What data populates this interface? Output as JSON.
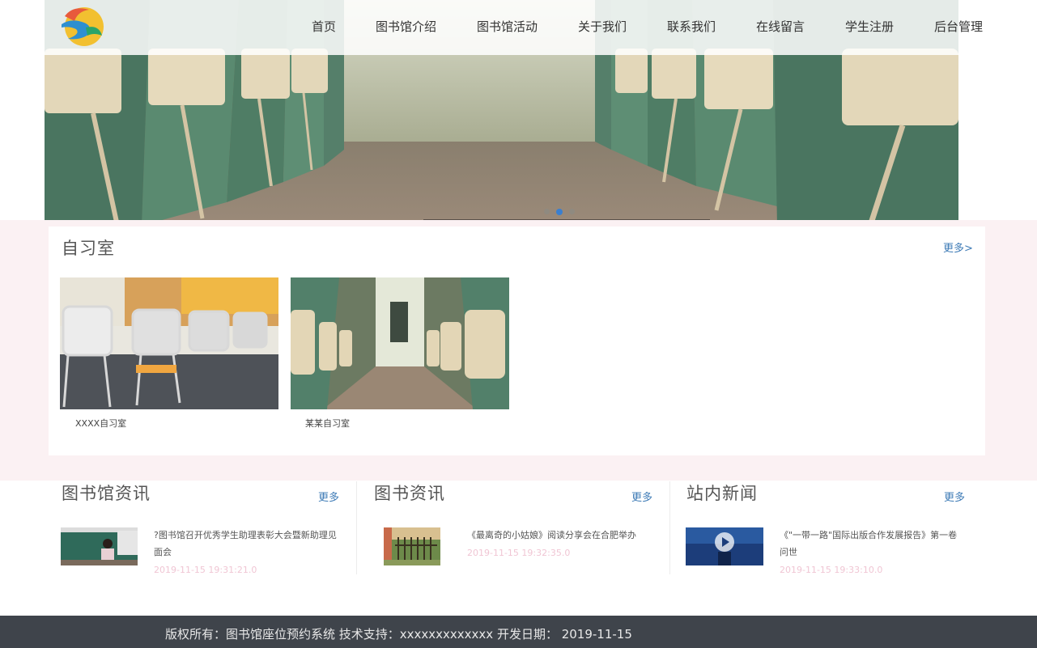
{
  "nav": {
    "items": [
      "首页",
      "图书馆介绍",
      "图书馆活动",
      "关于我们",
      "联系我们",
      "在线留言",
      "学生注册",
      "后台管理"
    ]
  },
  "banner": {
    "slides": 3,
    "active_slide": 2
  },
  "study": {
    "title": "自习室",
    "more": "更多>",
    "rooms": [
      {
        "label": "XXXX自习室"
      },
      {
        "label": "某某自习室"
      }
    ]
  },
  "news_sections": [
    {
      "title": "图书馆资讯",
      "more": "更多",
      "item": {
        "text": "?图书馆召开优秀学生助理表彰大会暨新助理见面会",
        "date": "2019-11-15 19:31:21.0"
      }
    },
    {
      "title": "图书资讯",
      "more": "更多",
      "item": {
        "text": "《最离奇的小姑娘》阅读分享会在合肥举办",
        "date": "2019-11-15 19:32:35.0"
      }
    },
    {
      "title": "站内新闻",
      "more": "更多",
      "item": {
        "text": "《\"一带一路\"国际出版合作发展报告》第一卷问世",
        "date": "2019-11-15 19:33:10.0"
      }
    }
  ],
  "footer": {
    "text": "版权所有：图书馆座位预约系统 技术支持：xxxxxxxxxxxxx 开发日期： 2019-11-15"
  },
  "colors": {
    "accent": "#3e7bb6",
    "footer_bg": "#3f444b",
    "pink_band": "#fbf1f3",
    "date": "#f0c6d4"
  }
}
